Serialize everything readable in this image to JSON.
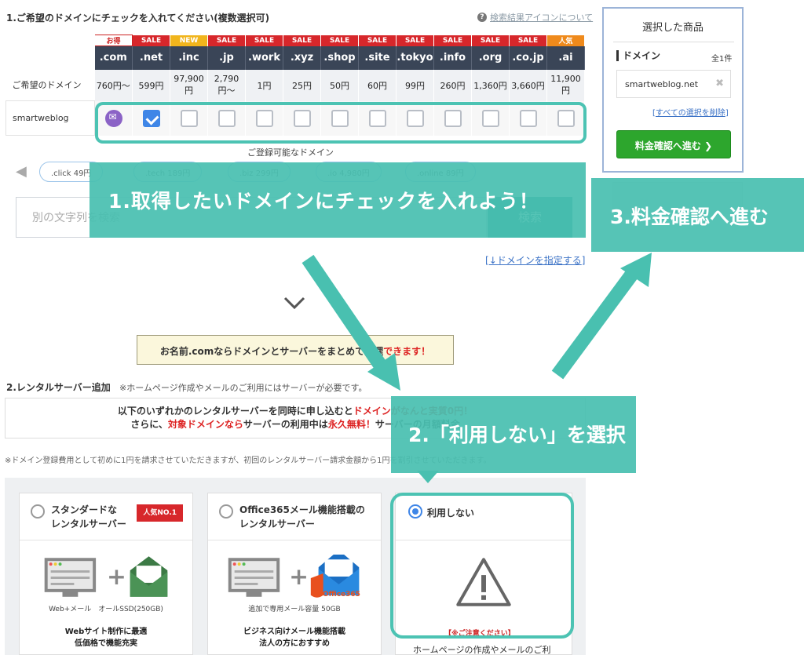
{
  "section1": {
    "title": "1.ご希望のドメインにチェックを入れてください(複数選択可)",
    "help_link": "検索結果アイコンについて"
  },
  "domain_table": {
    "row_label_price": "ご希望のドメイン",
    "row_label_name": "smartweblog",
    "columns": [
      {
        "badge": "お得",
        "tld": ".com",
        "price": "760円〜",
        "state": "mail"
      },
      {
        "badge": "SALE",
        "tld": ".net",
        "price": "599円",
        "state": "checked"
      },
      {
        "badge": "NEW",
        "tld": ".inc",
        "price": "97,900円",
        "state": "empty"
      },
      {
        "badge": "SALE",
        "tld": ".jp",
        "price": "2,790円〜",
        "state": "empty"
      },
      {
        "badge": "SALE",
        "tld": ".work",
        "price": "1円",
        "state": "empty"
      },
      {
        "badge": "SALE",
        "tld": ".xyz",
        "price": "25円",
        "state": "empty"
      },
      {
        "badge": "SALE",
        "tld": ".shop",
        "price": "50円",
        "state": "empty"
      },
      {
        "badge": "SALE",
        "tld": ".site",
        "price": "60円",
        "state": "empty"
      },
      {
        "badge": "SALE",
        "tld": ".tokyo",
        "price": "99円",
        "state": "empty"
      },
      {
        "badge": "SALE",
        "tld": ".info",
        "price": "260円",
        "state": "empty"
      },
      {
        "badge": "SALE",
        "tld": ".org",
        "price": "1,360円",
        "state": "empty"
      },
      {
        "badge": "SALE",
        "tld": ".co.jp",
        "price": "3,660円",
        "state": "empty"
      },
      {
        "badge": "人気",
        "tld": ".ai",
        "price": "11,900円",
        "state": "empty"
      }
    ]
  },
  "registrable_label": "ご登録可能なドメイン",
  "chips": [
    ".click 49円",
    ".tech 189円",
    ".biz 299円",
    ".io 4,980円",
    ".online 89円"
  ],
  "search": {
    "placeholder": "別の文字列を検索",
    "button": "検索"
  },
  "specify_link": "↓ドメインを指定する",
  "promo": {
    "text": "お名前.comならドメインとサーバーをまとめて管理",
    "emph": "できます！"
  },
  "section2": {
    "title": "2.レンタルサーバー追加",
    "note": "※ホームページ作成やメールのご利用にはサーバーが必要です。"
  },
  "info_box": {
    "line1_a": "以下のいずれかのレンタルサーバーを同時に申し込むと",
    "line1_b": "ドメインがなんと実質0円！",
    "line2_a": "さらに、",
    "line2_b": "対象ドメインなら",
    "line2_c": "サーバーの利用中は",
    "line2_d": "永久無料！",
    "line2_e": "サーバーの月額料金"
  },
  "fine_note": "※ドメイン登録費用として初めに1円を請求させていただきますが、初回のレンタルサーバー請求金額から1円を割引させていただきます。",
  "plans": [
    {
      "title": "スタンダードな\nレンタルサーバー",
      "badge": "人気NO.1",
      "caption": "Web+メール　オールSSD(250GB)",
      "desc": "Webサイト制作に最適\n低価格で機能充実",
      "selected": false
    },
    {
      "title": "Office365メール機能搭載の\nレンタルサーバー",
      "badge": "",
      "caption": "追加で専用メール容量 50GB",
      "desc": "ビジネス向けメール機能搭載\n法人の方におすすめ",
      "selected": false,
      "logo": "Office365"
    },
    {
      "title": "利用しない",
      "badge": "",
      "caption": "",
      "desc": "",
      "selected": true,
      "note": "【※ご注意ください】",
      "foot": "ホームページの作成やメールのご利"
    }
  ],
  "cart": {
    "title": "選択した商品",
    "domain_label": "ドメイン",
    "count": "全1件",
    "item": "smartweblog.net",
    "delete_all": "すべての選択を削除",
    "button": "料金確認へ進む"
  },
  "callouts": {
    "step1": "1.取得したいドメインにチェックを入れよう！",
    "step2": "2.「利用しない」を選択",
    "step3": "3.料金確認へ進む"
  },
  "colors": {
    "accent": "#49c0b0",
    "header_dark": "#3a4557",
    "sale_red": "#d7272b",
    "cta_green": "#2da62d"
  }
}
